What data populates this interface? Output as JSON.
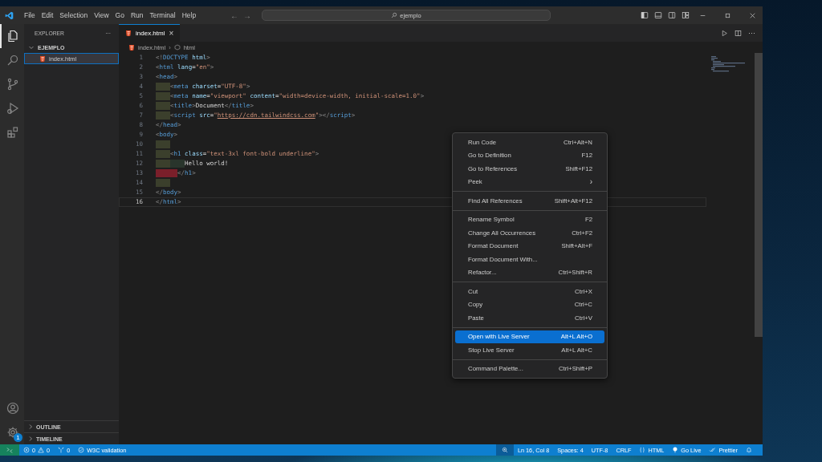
{
  "title_bar": {
    "menu": [
      "File",
      "Edit",
      "Selection",
      "View",
      "Go",
      "Run",
      "Terminal",
      "Help"
    ],
    "back": "←",
    "forward": "→",
    "search": "ejemplo"
  },
  "activity_bar": {
    "top": [
      {
        "kind": "explorer",
        "selected": true
      },
      {
        "kind": "search",
        "selected": false
      },
      {
        "kind": "source-control",
        "selected": false
      },
      {
        "kind": "run-debug",
        "selected": false
      },
      {
        "kind": "extensions",
        "selected": false
      }
    ],
    "bottom": [
      {
        "kind": "account"
      },
      {
        "kind": "settings",
        "badge": "1"
      }
    ]
  },
  "sidebar": {
    "title": "EXPLORER",
    "more": "···",
    "tree": [
      {
        "label": "EJEMPLO",
        "expanded": true,
        "children": [
          {
            "label": "index.html",
            "selected": true
          }
        ]
      }
    ],
    "sections": [
      {
        "label": "OUTLINE",
        "expanded": false
      },
      {
        "label": "TIMELINE",
        "expanded": false
      }
    ]
  },
  "editor": {
    "tabs": [
      {
        "label": "index.html",
        "selected": true,
        "close": "×"
      }
    ],
    "more": "···",
    "breadcrumb": {
      "items": [
        "index.html",
        "html"
      ],
      "separator": "›"
    },
    "lines": [
      {
        "number": "1",
        "current": false,
        "tokens": [
          {
            "kind": "p",
            "text": "<!"
          },
          {
            "kind": "t",
            "text": "DOCTYPE"
          },
          {
            "kind": "a",
            "text": " html"
          },
          {
            "kind": "p",
            "text": ">"
          }
        ]
      },
      {
        "number": "2",
        "current": false,
        "tokens": [
          {
            "kind": "p",
            "text": "<"
          },
          {
            "kind": "t",
            "text": "html"
          },
          {
            "kind": "a",
            "text": " lang"
          },
          {
            "kind": "x",
            "text": "="
          },
          {
            "kind": "s",
            "text": "\"en\""
          },
          {
            "kind": "p",
            "text": ">"
          }
        ]
      },
      {
        "number": "3",
        "current": false,
        "tokens": [
          {
            "kind": "p",
            "text": "<"
          },
          {
            "kind": "t",
            "text": "head"
          },
          {
            "kind": "p",
            "text": ">"
          }
        ]
      },
      {
        "number": "4",
        "current": false,
        "indent": [
          {
            "kind": "ok"
          }
        ],
        "tokens": [
          {
            "kind": "p",
            "text": "<"
          },
          {
            "kind": "t",
            "text": "meta"
          },
          {
            "kind": "a",
            "text": " charset"
          },
          {
            "kind": "x",
            "text": "="
          },
          {
            "kind": "s",
            "text": "\"UTF-8\""
          },
          {
            "kind": "p",
            "text": ">"
          }
        ]
      },
      {
        "number": "5",
        "current": false,
        "indent": [
          {
            "kind": "ok"
          }
        ],
        "tokens": [
          {
            "kind": "p",
            "text": "<"
          },
          {
            "kind": "t",
            "text": "meta"
          },
          {
            "kind": "a",
            "text": " name"
          },
          {
            "kind": "x",
            "text": "="
          },
          {
            "kind": "s",
            "text": "\"viewport\""
          },
          {
            "kind": "a",
            "text": " content"
          },
          {
            "kind": "x",
            "text": "="
          },
          {
            "kind": "s",
            "text": "\"width=device-width, initial-scale=1.0\""
          },
          {
            "kind": "p",
            "text": ">"
          }
        ]
      },
      {
        "number": "6",
        "current": false,
        "indent": [
          {
            "kind": "ok"
          }
        ],
        "tokens": [
          {
            "kind": "p",
            "text": "<"
          },
          {
            "kind": "t",
            "text": "title"
          },
          {
            "kind": "p",
            "text": ">"
          },
          {
            "kind": "x",
            "text": "Document"
          },
          {
            "kind": "p",
            "text": "</"
          },
          {
            "kind": "t",
            "text": "title"
          },
          {
            "kind": "p",
            "text": ">"
          }
        ]
      },
      {
        "number": "7",
        "current": false,
        "indent": [
          {
            "kind": "ok"
          }
        ],
        "tokens": [
          {
            "kind": "p",
            "text": "<"
          },
          {
            "kind": "t",
            "text": "script"
          },
          {
            "kind": "a",
            "text": " src"
          },
          {
            "kind": "x",
            "text": "="
          },
          {
            "kind": "s",
            "text": "\""
          },
          {
            "kind": "u",
            "text": "https://cdn.tailwindcss.com"
          },
          {
            "kind": "s",
            "text": "\""
          },
          {
            "kind": "p",
            "text": "></"
          },
          {
            "kind": "t",
            "text": "script"
          },
          {
            "kind": "p",
            "text": ">"
          }
        ]
      },
      {
        "number": "8",
        "current": false,
        "tokens": [
          {
            "kind": "p",
            "text": "</"
          },
          {
            "kind": "t",
            "text": "head"
          },
          {
            "kind": "p",
            "text": ">"
          }
        ]
      },
      {
        "number": "9",
        "current": false,
        "tokens": [
          {
            "kind": "p",
            "text": "<"
          },
          {
            "kind": "t",
            "text": "body"
          },
          {
            "kind": "p",
            "text": ">"
          }
        ]
      },
      {
        "number": "10",
        "current": false,
        "indent": [
          {
            "kind": "ok"
          }
        ]
      },
      {
        "number": "11",
        "current": false,
        "indent": [
          {
            "kind": "ok"
          }
        ],
        "tokens": [
          {
            "kind": "p",
            "text": "<"
          },
          {
            "kind": "t",
            "text": "h1"
          },
          {
            "kind": "a",
            "text": " class"
          },
          {
            "kind": "x",
            "text": "="
          },
          {
            "kind": "s",
            "text": "\"text-3xl font-bold underline\""
          },
          {
            "kind": "p",
            "text": ">"
          }
        ]
      },
      {
        "number": "12",
        "current": false,
        "indent": [
          {
            "kind": "ok"
          },
          {
            "kind": "ok2"
          }
        ],
        "tokens": [
          {
            "kind": "x",
            "text": "Hello world!"
          }
        ]
      },
      {
        "number": "13",
        "current": false,
        "indent": [
          {
            "kind": "error"
          }
        ],
        "tokens": [
          {
            "kind": "p",
            "text": "</"
          },
          {
            "kind": "t",
            "text": "h1"
          },
          {
            "kind": "p",
            "text": ">"
          }
        ]
      },
      {
        "number": "14",
        "current": false,
        "indent": [
          {
            "kind": "ok"
          }
        ]
      },
      {
        "number": "15",
        "current": false,
        "tokens": [
          {
            "kind": "p",
            "text": "</"
          },
          {
            "kind": "t",
            "text": "body"
          },
          {
            "kind": "p",
            "text": ">"
          }
        ]
      },
      {
        "number": "16",
        "current": true,
        "tokens": [
          {
            "kind": "p",
            "text": "</"
          },
          {
            "kind": "t",
            "text": "html"
          },
          {
            "kind": "p",
            "text": ">"
          }
        ]
      }
    ]
  },
  "context_menu": [
    {
      "kind": "item",
      "label": "Run Code",
      "shortcut": "Ctrl+Alt+N",
      "selected": false
    },
    {
      "kind": "item",
      "label": "Go to Definition",
      "shortcut": "F12",
      "selected": false
    },
    {
      "kind": "item",
      "label": "Go to References",
      "shortcut": "Shift+F12",
      "selected": false
    },
    {
      "kind": "submenu",
      "label": "Peek",
      "arrow": "›",
      "selected": false
    },
    {
      "kind": "separator"
    },
    {
      "kind": "item",
      "label": "Find All References",
      "shortcut": "Shift+Alt+F12",
      "selected": false
    },
    {
      "kind": "separator"
    },
    {
      "kind": "item",
      "label": "Rename Symbol",
      "shortcut": "F2",
      "selected": false
    },
    {
      "kind": "item",
      "label": "Change All Occurrences",
      "shortcut": "Ctrl+F2",
      "selected": false
    },
    {
      "kind": "item",
      "label": "Format Document",
      "shortcut": "Shift+Alt+F",
      "selected": false
    },
    {
      "kind": "item",
      "label": "Format Document With...",
      "selected": false
    },
    {
      "kind": "item",
      "label": "Refactor...",
      "shortcut": "Ctrl+Shift+R",
      "selected": false
    },
    {
      "kind": "separator"
    },
    {
      "kind": "item",
      "label": "Cut",
      "shortcut": "Ctrl+X",
      "selected": false
    },
    {
      "kind": "item",
      "label": "Copy",
      "shortcut": "Ctrl+C",
      "selected": false
    },
    {
      "kind": "item",
      "label": "Paste",
      "shortcut": "Ctrl+V",
      "selected": false
    },
    {
      "kind": "separator"
    },
    {
      "kind": "item",
      "label": "Open with Live Server",
      "shortcut": "Alt+L Alt+O",
      "selected": true
    },
    {
      "kind": "item",
      "label": "Stop Live Server",
      "shortcut": "Alt+L Alt+C",
      "selected": false
    },
    {
      "kind": "separator"
    },
    {
      "kind": "item",
      "label": "Command Palette...",
      "shortcut": "Ctrl+Shift+P",
      "selected": false
    }
  ],
  "status_bar": {
    "left": [
      {
        "kind": "remote"
      },
      {
        "kind": "problems",
        "errors": "0",
        "warnings": "0"
      },
      {
        "kind": "ports",
        "text": "0"
      },
      {
        "kind": "check",
        "text": "W3C validation"
      }
    ],
    "right": [
      {
        "kind": "zoom"
      },
      {
        "kind": "text",
        "text": "Ln 16, Col 8"
      },
      {
        "kind": "text",
        "text": "Spaces: 4"
      },
      {
        "kind": "text",
        "text": "UTF-8"
      },
      {
        "kind": "text",
        "text": "CRLF"
      },
      {
        "kind": "language",
        "text": "HTML"
      },
      {
        "kind": "golive",
        "text": "Go Live"
      },
      {
        "kind": "prettier",
        "text": "Prettier"
      },
      {
        "kind": "bell"
      }
    ]
  }
}
